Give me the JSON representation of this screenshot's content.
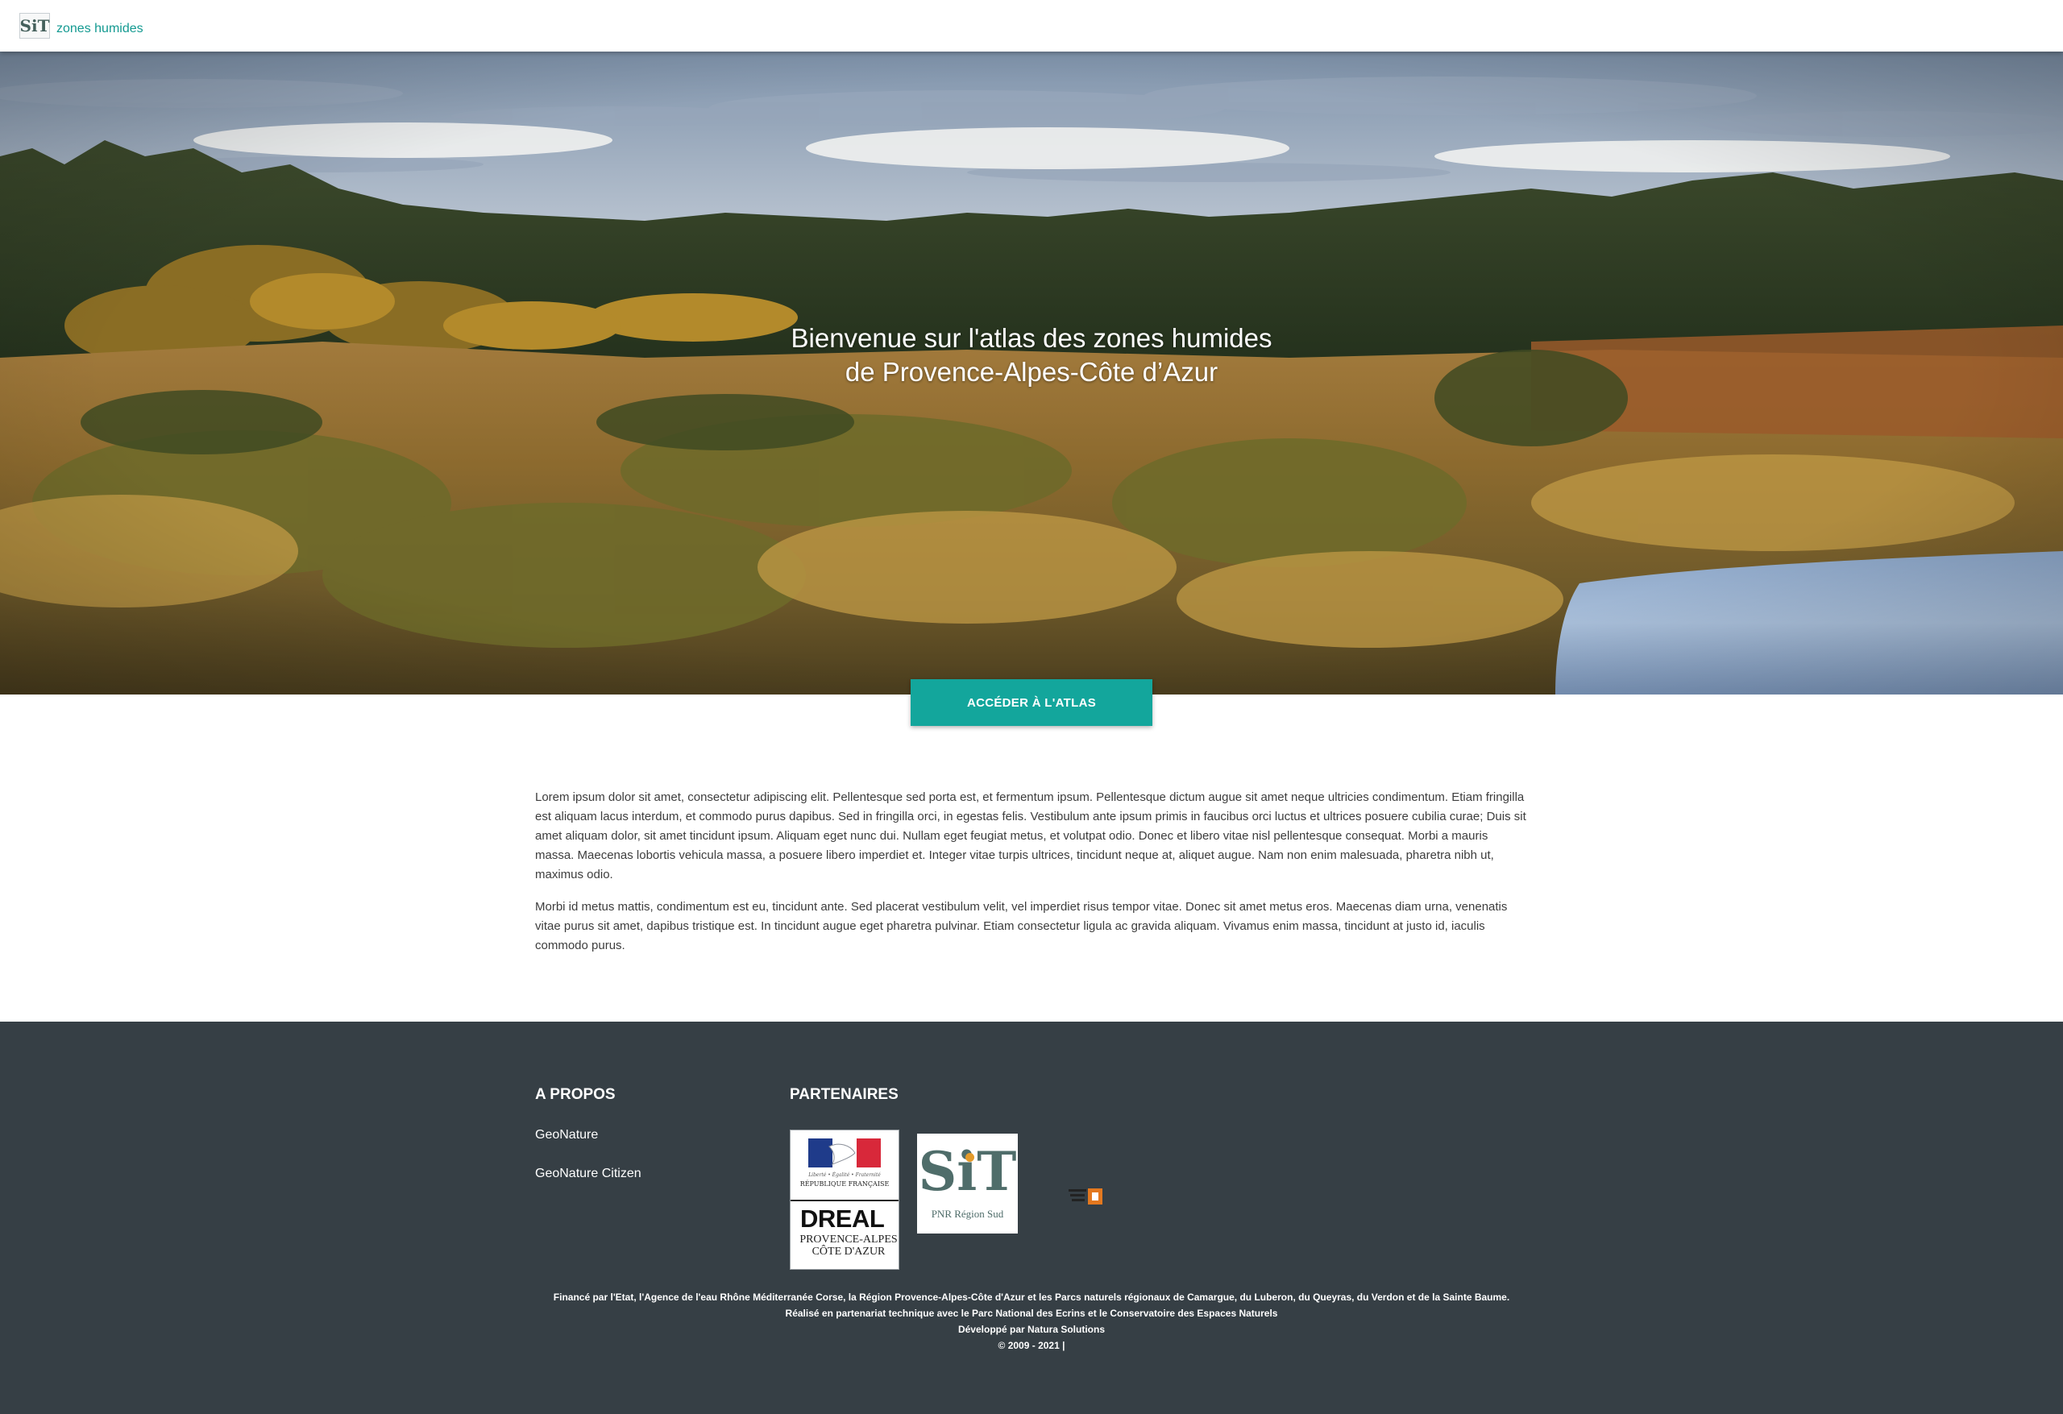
{
  "header": {
    "logo_text": "SiT",
    "site_name": "zones humides"
  },
  "hero": {
    "title": "Bienvenue sur l'atlas des zones humides de Provence-Alpes-Côte d’Azur",
    "cta_label": "ACCÉDER À L'ATLAS"
  },
  "content": {
    "paragraphs": [
      "Lorem ipsum dolor sit amet, consectetur adipiscing elit. Pellentesque sed porta est, et fermentum ipsum. Pellentesque dictum augue sit amet neque ultricies condimentum. Etiam fringilla est aliquam lacus interdum, et commodo purus dapibus. Sed in fringilla orci, in egestas felis. Vestibulum ante ipsum primis in faucibus orci luctus et ultrices posuere cubilia curae; Duis sit amet aliquam dolor, sit amet tincidunt ipsum. Aliquam eget nunc dui. Nullam eget feugiat metus, et volutpat odio. Donec et libero vitae nisl pellentesque consequat. Morbi a mauris massa. Maecenas lobortis vehicula massa, a posuere libero imperdiet et. Integer vitae turpis ultrices, tincidunt neque at, aliquet augue. Nam non enim malesuada, pharetra nibh ut, maximus odio.",
      "Morbi id metus mattis, condimentum est eu, tincidunt ante. Sed placerat vestibulum velit, vel imperdiet risus tempor vitae. Donec sit amet metus eros. Maecenas diam urna, venenatis vitae purus sit amet, dapibus tristique est. In tincidunt augue eget pharetra pulvinar. Etiam consectetur ligula ac gravida aliquam. Vivamus enim massa, tincidunt at justo id, iaculis commodo purus."
    ]
  },
  "footer": {
    "about_title": "A PROPOS",
    "about_links": [
      "GeoNature",
      "GeoNature Citizen"
    ],
    "partners_title": "PARTENAIRES",
    "partners": {
      "rf_label": "RÉPUBLIQUE FRANÇAISE",
      "rf_motto": "Liberté • Égalité • Fraternité",
      "dreal_title": "DREAL",
      "dreal_line1": "PROVENCE-ALPES",
      "dreal_line2": "CÔTE D'AZUR",
      "sit_letters": "SiT",
      "sit_caption": "PNR Région Sud"
    },
    "lines": [
      "Financé par l'Etat, l'Agence de l'eau Rhône Méditerranée Corse, la Région Provence-Alpes-Côte d'Azur et les Parcs naturels régionaux de Camargue, du Luberon, du Queyras, du Verdon et de la Sainte Baume.",
      "Réalisé en partenariat technique avec le Parc National des Ecrins et le Conservatoire des Espaces Naturels",
      "Développé par Natura Solutions",
      "© 2009 - 2021 |"
    ]
  },
  "colors": {
    "accent": "#13a69c",
    "footer_bg": "#363f45",
    "brand_text": "#149a91"
  }
}
